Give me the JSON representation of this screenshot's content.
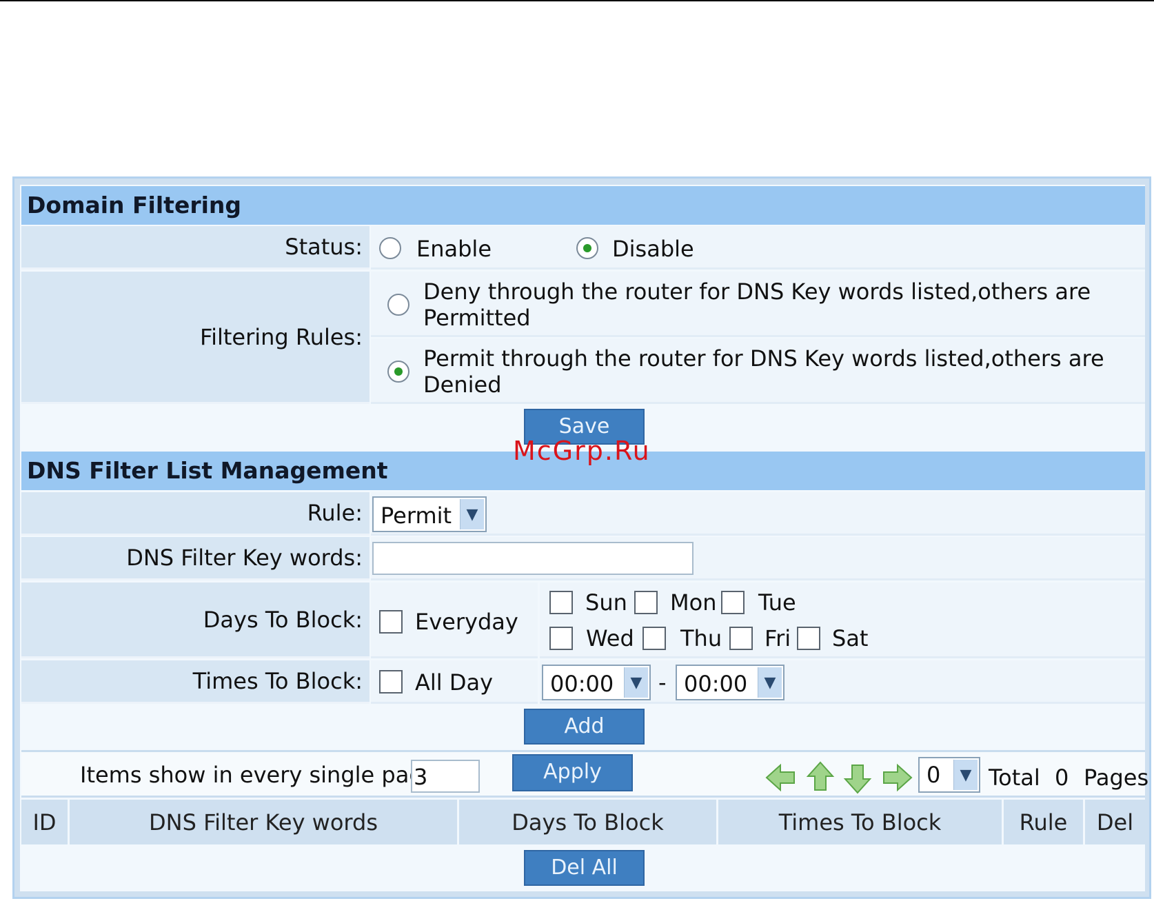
{
  "domain_filtering": {
    "title": "Domain Filtering",
    "status_label": "Status:",
    "status_options": [
      "Enable",
      "Disable"
    ],
    "status_selected": "Disable",
    "rules_label": "Filtering Rules:",
    "rule_deny_line1": "Deny through the router for DNS Key words listed,others are",
    "rule_deny_line2": "Permitted",
    "rule_permit_line1": "Permit through the router for DNS Key words listed,others are",
    "rule_permit_line2": "Denied",
    "rule_selected": "Permit",
    "save_label": "Save"
  },
  "watermark": "McGrp.Ru",
  "dns_list": {
    "title": "DNS Filter List Management",
    "rule_label": "Rule:",
    "rule_value": "Permit",
    "keywords_label": "DNS Filter Key words:",
    "keywords_value": "",
    "days_label": "Days To Block:",
    "everyday_label": "Everyday",
    "days": [
      "Sun",
      "Mon",
      "Tue",
      "Wed",
      "Thu",
      "Fri",
      "Sat"
    ],
    "times_label": "Times To Block:",
    "allday_label": "All Day",
    "time_from": "00:00",
    "time_sep": "-",
    "time_to": "00:00",
    "add_label": "Add"
  },
  "pager": {
    "items_label": "Items show in every single page",
    "items_value": "3",
    "apply_label": "Apply",
    "page_select": "0",
    "total_label": "Total",
    "total_value": "0",
    "pages_label": "Pages"
  },
  "table": {
    "columns": [
      "ID",
      "DNS Filter Key words",
      "Days To Block",
      "Times To Block",
      "Rule",
      "Del"
    ],
    "del_all_label": "Del All"
  },
  "colors": {
    "header_bg": "#99c7f2",
    "button_bg": "#3f7fc1",
    "watermark": "#d9141b"
  }
}
